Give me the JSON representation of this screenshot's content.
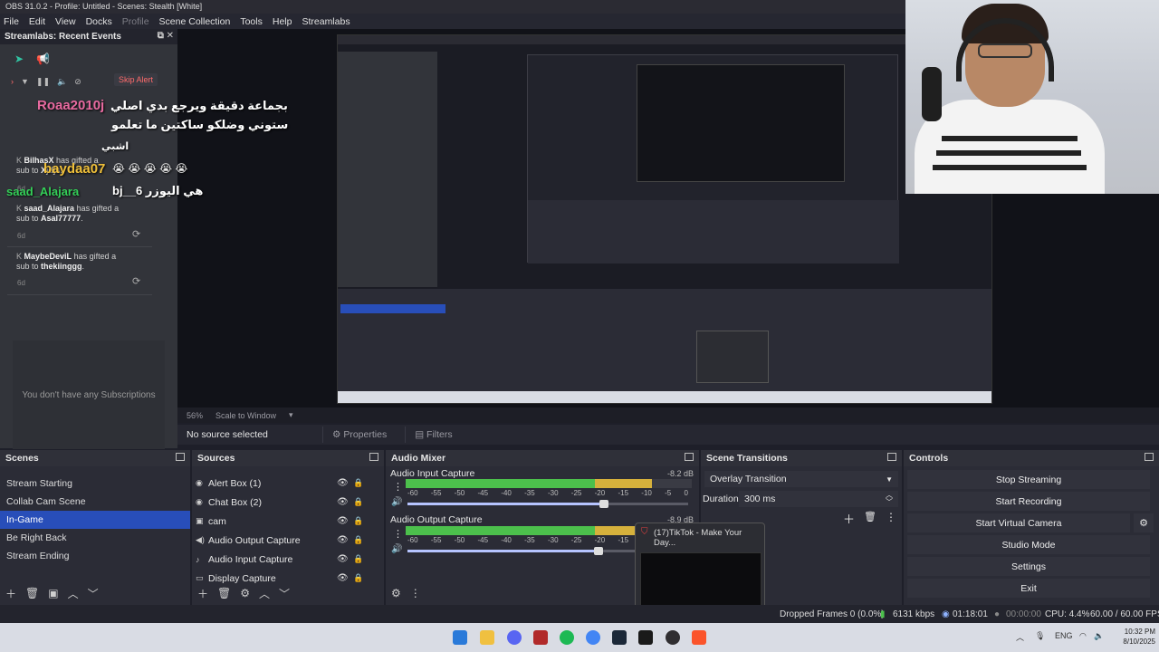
{
  "window": {
    "title": "OBS 31.0.2 - Profile: Untitled - Scenes: Stealth [White]"
  },
  "menu": [
    "File",
    "Edit",
    "View",
    "Docks",
    "Profile",
    "Scene Collection",
    "Tools",
    "Help",
    "Streamlabs"
  ],
  "events": {
    "title": "Streamlabs: Recent Events",
    "skip_label": "Skip Alert",
    "items": [
      {
        "user": "BilhasX",
        "text": "has gifted a",
        "text2": "sub to",
        "target": "Xjdjs",
        "ago": "6d"
      },
      {
        "user": "saad_Alajara",
        "text": "has gifted a",
        "text2": "sub to",
        "target": "Asal77777",
        "ago": "6d"
      },
      {
        "user": "MaybeDeviL",
        "text": "has gifted a",
        "text2": "sub to",
        "target": "thekiinggg",
        "ago": "6d"
      }
    ],
    "no_subs": "You don't have any Subscriptions"
  },
  "chat": {
    "line1_user": "Roaa2010j",
    "line1_msg": "بجماعة دقيقة ويرجع بدي اصلي",
    "line2_msg": "ستوني وضلكو ساكتين ما تعلمو",
    "line3_msg": "اشبي",
    "line4_user": "baydaa07",
    "line4_emoji": "😭 😭 😭 😭 😭",
    "line5_user": "saad_Alajara",
    "line5_msg": "bj__6 هي اليوزر"
  },
  "preview_status": {
    "zoom": "56%",
    "scale": "Scale to Window"
  },
  "source_bar": {
    "selected": "No source selected",
    "properties": "Properties",
    "filters": "Filters"
  },
  "scenes": {
    "title": "Scenes",
    "items": [
      "Stream Starting",
      "Collab Cam Scene",
      "In-Game",
      "Be Right Back",
      "Stream Ending"
    ],
    "selected_index": 2
  },
  "sources": {
    "title": "Sources",
    "items": [
      "Alert Box (1)",
      "Chat Box (2)",
      "cam",
      "Audio Output Capture",
      "Audio Input Capture",
      "Display Capture"
    ]
  },
  "audio": {
    "title": "Audio Mixer",
    "channels": [
      {
        "name": "Audio Input Capture",
        "db": "-8.2 dB",
        "level": 0.86,
        "volume": 0.7
      },
      {
        "name": "Audio Output Capture",
        "db": "-8.9 dB",
        "level": 0.84,
        "volume": 0.68
      }
    ],
    "scale": [
      "-60",
      "-55",
      "-50",
      "-45",
      "-40",
      "-35",
      "-30",
      "-25",
      "-20",
      "-15",
      "-10",
      "-5",
      "0"
    ]
  },
  "transitions": {
    "title": "Scene Transitions",
    "selected": "Overlay Transition",
    "duration_label": "Duration",
    "duration": "300 ms"
  },
  "controls": {
    "title": "Controls",
    "buttons": [
      "Stop Streaming",
      "Start Recording",
      "Start Virtual Camera",
      "Studio Mode",
      "Settings",
      "Exit"
    ]
  },
  "popup": {
    "title": "(17)TikTok - Make Your Day..."
  },
  "status": {
    "dropped": "Dropped Frames 0 (0.0%)",
    "bitrate": "6131 kbps",
    "live_time": "01:18:01",
    "rec_time": "00:00:00",
    "cpu": "CPU: 4.4%",
    "fps": "60.00 / 60.00 FPS"
  },
  "taskbar": {
    "lang": "ENG",
    "time": "10:32 PM",
    "date": "8/10/2025"
  },
  "colors": {
    "selected": "#284eb9",
    "meter_green": "#4cc04c",
    "meter_yellow": "#d6b13c",
    "meter_red": "#b93434",
    "accent_teal": "#31c3a2",
    "chat_user": "#e86aa0",
    "chat_user_alt": "#f0c03a",
    "chat_user_green": "#34d058"
  }
}
